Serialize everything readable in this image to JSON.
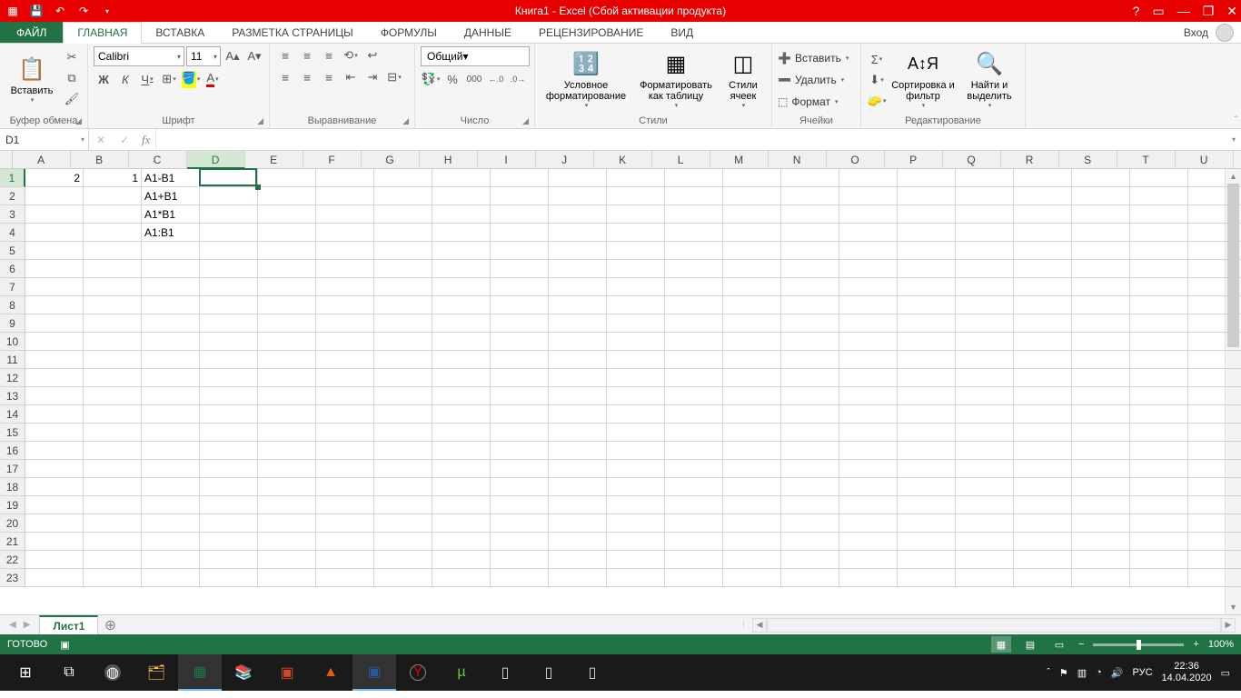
{
  "titlebar": {
    "title": "Книга1 -  Excel (Сбой активации продукта)"
  },
  "tabs": {
    "file": "ФАЙЛ",
    "items": [
      "ГЛАВНАЯ",
      "ВСТАВКА",
      "РАЗМЕТКА СТРАНИЦЫ",
      "ФОРМУЛЫ",
      "ДАННЫЕ",
      "РЕЦЕНЗИРОВАНИЕ",
      "ВИД"
    ],
    "signin": "Вход"
  },
  "ribbon": {
    "clipboard": {
      "paste": "Вставить",
      "label": "Буфер обмена"
    },
    "font": {
      "name": "Calibri",
      "size": "11",
      "label": "Шрифт",
      "bold": "Ж",
      "italic": "К",
      "underline": "Ч"
    },
    "alignment": {
      "label": "Выравнивание"
    },
    "number": {
      "format": "Общий",
      "label": "Число"
    },
    "styles": {
      "cond": "Условное форматирование",
      "table": "Форматировать как таблицу",
      "cell": "Стили ячеек",
      "label": "Стили"
    },
    "cells": {
      "insert": "Вставить",
      "delete": "Удалить",
      "format": "Формат",
      "label": "Ячейки"
    },
    "editing": {
      "sort": "Сортировка и фильтр",
      "find": "Найти и выделить",
      "label": "Редактирование"
    }
  },
  "namebox": "D1",
  "columns": [
    "A",
    "B",
    "C",
    "D",
    "E",
    "F",
    "G",
    "H",
    "I",
    "J",
    "K",
    "L",
    "M",
    "N",
    "O",
    "P",
    "Q",
    "R",
    "S",
    "T",
    "U"
  ],
  "rows": [
    "1",
    "2",
    "3",
    "4",
    "5",
    "6",
    "7",
    "8",
    "9",
    "10",
    "11",
    "12",
    "13",
    "14",
    "15",
    "16",
    "17",
    "18",
    "19",
    "20",
    "21",
    "22",
    "23"
  ],
  "cells": {
    "A1": "2",
    "B1": "1",
    "C1": "A1-B1",
    "C2": "A1+B1",
    "C3": "A1*B1",
    "C4": "A1:B1"
  },
  "active_col": 3,
  "active_row": 0,
  "sheet": {
    "name": "Лист1"
  },
  "status": {
    "ready": "ГОТОВО",
    "zoom": "100%"
  },
  "taskbar": {
    "lang": "РУС",
    "time": "22:36",
    "date": "14.04.2020"
  }
}
